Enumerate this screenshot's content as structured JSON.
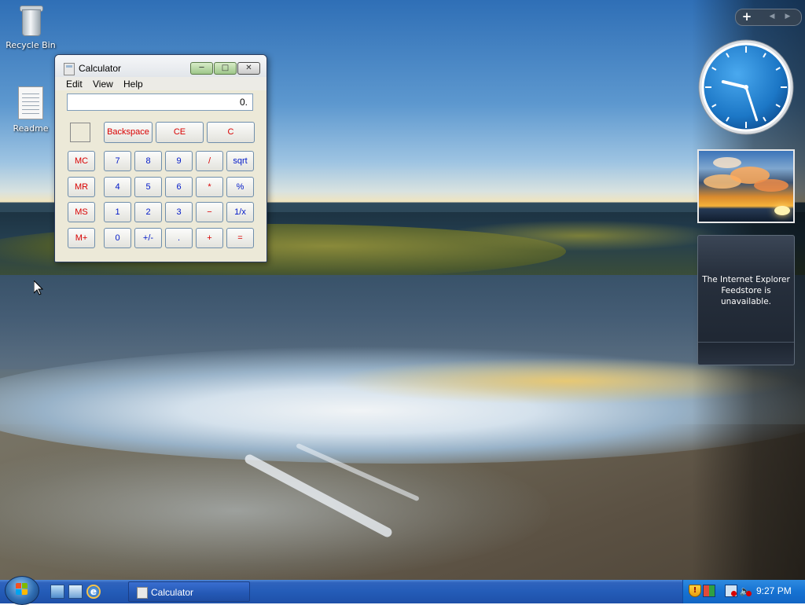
{
  "desktop": {
    "icons": [
      {
        "label": "Recycle Bin",
        "icon": "recycle-bin-icon"
      },
      {
        "label": "Readme",
        "icon": "text-document-icon"
      }
    ]
  },
  "calculator": {
    "title": "Calculator",
    "window_controls": {
      "minimize": "minimize-icon",
      "maximize": "maximize-icon",
      "close": "close-icon"
    },
    "menu": [
      "Edit",
      "View",
      "Help"
    ],
    "display": "0.",
    "buttons": {
      "backspace": "Backspace",
      "ce": "CE",
      "c": "C",
      "mc": "MC",
      "mr": "MR",
      "ms": "MS",
      "mplus": "M+",
      "n7": "7",
      "n8": "8",
      "n9": "9",
      "div": "/",
      "sqrt": "sqrt",
      "n4": "4",
      "n5": "5",
      "n6": "6",
      "mul": "*",
      "pct": "%",
      "n1": "1",
      "n2": "2",
      "n3": "3",
      "sub": "−",
      "inv": "1/x",
      "n0": "0",
      "sign": "+/-",
      "dot": ".",
      "add": "+",
      "eq": "="
    },
    "colors": {
      "red_text": "#d80000",
      "blue_text": "#0018c8"
    }
  },
  "sidebar": {
    "toolbar": {
      "add": "+",
      "prev": "◀",
      "next": "▶"
    },
    "clock": {
      "hour": 9,
      "minute": 27
    },
    "feeds_message": "The Internet Explorer Feedstore is unavailable."
  },
  "taskbar": {
    "start_icon": "windows-start-orb-icon",
    "quick_launch": [
      "show-desktop-icon",
      "switch-windows-icon",
      "internet-explorer-icon"
    ],
    "tasks": [
      {
        "label": "Calculator",
        "icon": "calculator-icon"
      }
    ],
    "tray": [
      "security-shield-icon",
      "security-center-icon",
      "network-icon",
      "volume-icon"
    ],
    "clock": "9:27 PM"
  }
}
